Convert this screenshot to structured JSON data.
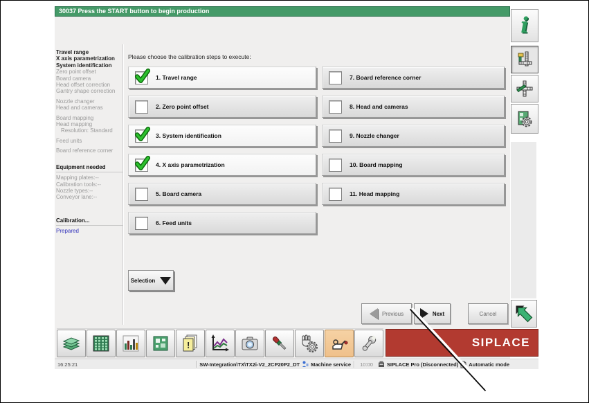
{
  "header": {
    "message": "30037 Press the START button to begin production"
  },
  "sidebar": {
    "groups": [
      {
        "lines": [
          {
            "text": "Travel range",
            "style": "dark"
          },
          {
            "text": "X axis parametrization",
            "style": "dark"
          },
          {
            "text": "System identification",
            "style": "dark"
          },
          {
            "text": "Zero point offset",
            "style": ""
          },
          {
            "text": "Board camera",
            "style": ""
          },
          {
            "text": "Head offset correction",
            "style": ""
          },
          {
            "text": "Gantry shape correction",
            "style": ""
          }
        ]
      },
      {
        "lines": [
          {
            "text": "Nozzle changer",
            "style": ""
          },
          {
            "text": "Head and cameras",
            "style": ""
          }
        ]
      },
      {
        "lines": [
          {
            "text": "Board mapping",
            "style": ""
          },
          {
            "text": "Head mapping",
            "style": ""
          },
          {
            "text": "Resolution: Standard",
            "style": "indent"
          }
        ]
      },
      {
        "lines": [
          {
            "text": "Feed units",
            "style": ""
          }
        ]
      },
      {
        "lines": [
          {
            "text": "Board reference corner",
            "style": ""
          }
        ]
      },
      {
        "class": "mt12",
        "lines": [
          {
            "text": "Equipment needed",
            "style": "heading"
          },
          {
            "text": "Mapping plates:--",
            "style": ""
          },
          {
            "text": "Calibration tools:--",
            "style": ""
          },
          {
            "text": "Nozzle types:--",
            "style": ""
          },
          {
            "text": "Conveyor lane:--",
            "style": ""
          }
        ]
      },
      {
        "class": "mt22",
        "lines": [
          {
            "text": "Calibration...",
            "style": "heading"
          },
          {
            "text": "Prepared",
            "style": "blue"
          }
        ]
      }
    ]
  },
  "main": {
    "prompt": "Please choose the calibration steps to execute:",
    "selection_label": "Selection",
    "steps": [
      {
        "label": "1. Travel range",
        "checked": true,
        "col": 1
      },
      {
        "label": "2. Zero point offset",
        "checked": false,
        "col": 1
      },
      {
        "label": "3. System identification",
        "checked": true,
        "col": 1
      },
      {
        "label": "4. X axis parametrization",
        "checked": true,
        "col": 1
      },
      {
        "label": "5. Board camera",
        "checked": false,
        "col": 1
      },
      {
        "label": "6. Feed units",
        "checked": false,
        "col": 1
      },
      {
        "label": "7. Board reference corner",
        "checked": false,
        "col": 2
      },
      {
        "label": "8. Head and cameras",
        "checked": false,
        "col": 2
      },
      {
        "label": "9. Nozzle changer",
        "checked": false,
        "col": 2
      },
      {
        "label": "10. Board mapping",
        "checked": false,
        "col": 2
      },
      {
        "label": "11. Head mapping",
        "checked": false,
        "col": 2
      }
    ]
  },
  "actions": {
    "previous": "Previous",
    "next": "Next",
    "cancel": "Cancel"
  },
  "brand": {
    "logo": "SIPLACE"
  },
  "toolbar": {
    "active_index": 9,
    "icons": [
      "board-stack-icon",
      "feeder-grid-icon",
      "bar-chart-icon",
      "pcb-board-icon",
      "error-log-icon",
      "statistics-icon",
      "camera-icon",
      "screwdriver-icon",
      "hand-gear-icon",
      "oil-can-icon",
      "wrench-icon"
    ]
  },
  "right_toolbar": {
    "icons": [
      "info-icon",
      "gantry-ruler-icon",
      "axis-tool-icon",
      "board-gear-icon",
      "exit-icon"
    ]
  },
  "statusbar": {
    "time": "16:25:21",
    "path": "SW-Integration\\TX\\TX2i-V2_2CP20P2_DT",
    "user_mode": "Machine service",
    "duration": "10:00",
    "connection": "SIPLACE Pro (Disconnected)",
    "mode": "Automatic mode",
    "icons": [
      "operator-icon",
      "station-icon",
      "mode-page-icon"
    ]
  },
  "colors": {
    "green": "#459a68",
    "red": "#b23a30",
    "highlight": "#efc08a",
    "blue_text": "#3333bb",
    "check_green": "#2dc12e"
  }
}
